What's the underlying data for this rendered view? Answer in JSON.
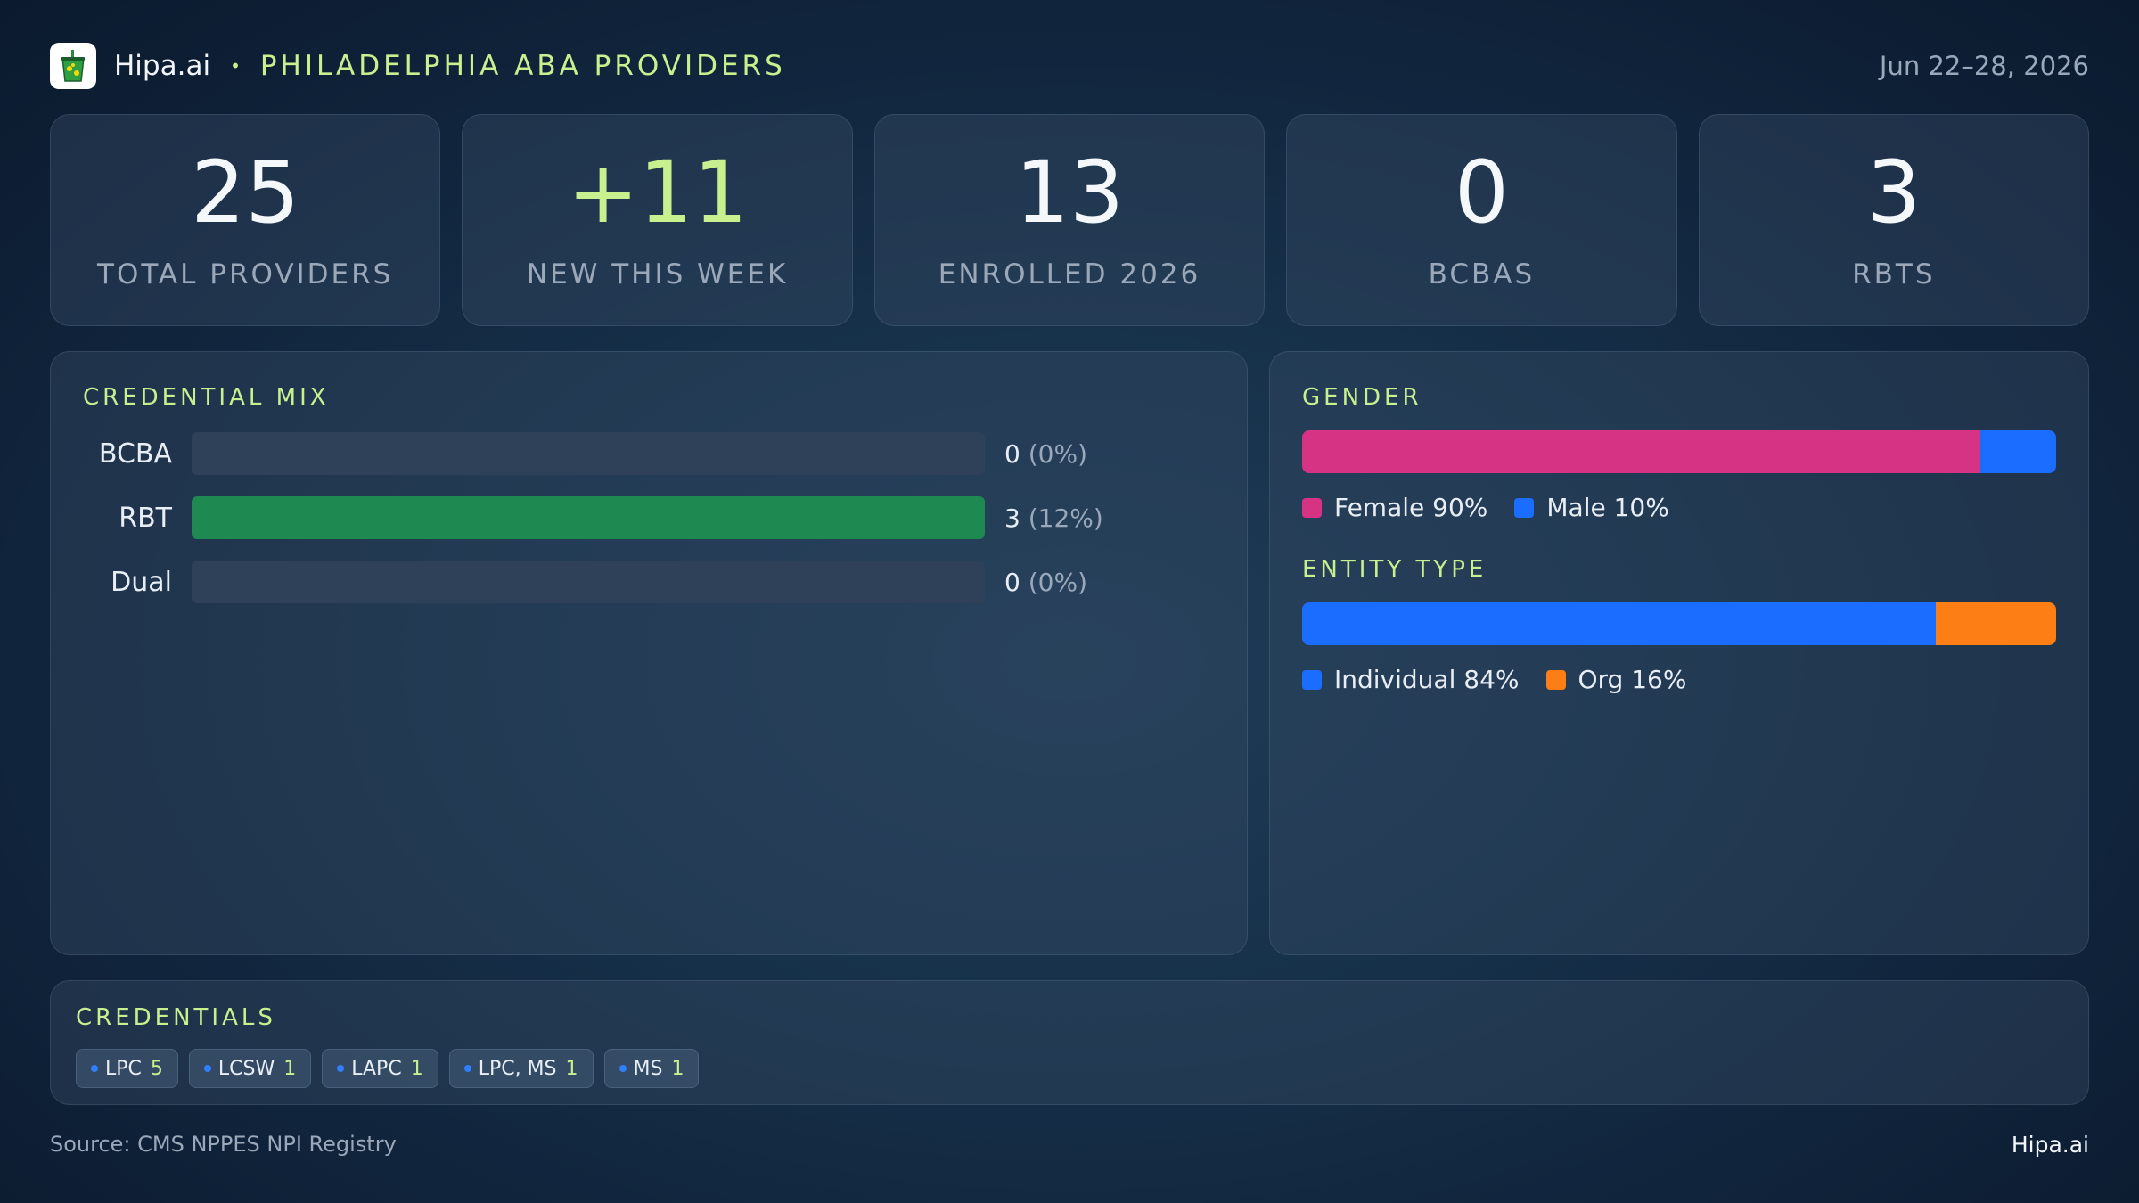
{
  "header": {
    "brand": "Hipa.ai",
    "separator": "•",
    "title": "PHILADELPHIA ABA PROVIDERS",
    "date_range": "Jun 22–28, 2026"
  },
  "kpis": [
    {
      "value": "25",
      "label": "TOTAL PROVIDERS"
    },
    {
      "value": "+11",
      "label": "NEW THIS WEEK"
    },
    {
      "value": "13",
      "label": "ENROLLED 2026"
    },
    {
      "value": "0",
      "label": "BCBAS"
    },
    {
      "value": "3",
      "label": "RBTS"
    }
  ],
  "credential_mix": {
    "title": "CREDENTIAL MIX",
    "rows": [
      {
        "label": "BCBA",
        "count": "0",
        "pct": "(0%)",
        "fraction": 0
      },
      {
        "label": "RBT",
        "count": "3",
        "pct": "(12%)",
        "fraction": 1
      },
      {
        "label": "Dual",
        "count": "0",
        "pct": "(0%)",
        "fraction": 0
      }
    ]
  },
  "gender": {
    "title": "GENDER",
    "segments": [
      {
        "name": "Female 90%",
        "fraction": 0.9,
        "color": "#d63384"
      },
      {
        "name": "Male 10%",
        "fraction": 0.1,
        "color": "#1a6dff"
      }
    ]
  },
  "entity_type": {
    "title": "ENTITY TYPE",
    "segments": [
      {
        "name": "Individual 84%",
        "fraction": 0.84,
        "color": "#1a6dff"
      },
      {
        "name": "Org 16%",
        "fraction": 0.16,
        "color": "#fd7e14"
      }
    ]
  },
  "credentials": {
    "title": "CREDENTIALS",
    "chips": [
      {
        "label": "LPC",
        "count": "5"
      },
      {
        "label": "LCSW",
        "count": "1"
      },
      {
        "label": "LAPC",
        "count": "1"
      },
      {
        "label": "LPC, MS",
        "count": "1"
      },
      {
        "label": "MS",
        "count": "1"
      }
    ]
  },
  "footer": {
    "source": "Source: CMS NPPES NPI Registry",
    "brand": "Hipa.ai"
  },
  "colors": {
    "accent": "#c8f08f",
    "rbt_bar": "#1e8a52",
    "female": "#d63384",
    "male": "#1a6dff",
    "individual": "#1a6dff",
    "org": "#fd7e14"
  }
}
